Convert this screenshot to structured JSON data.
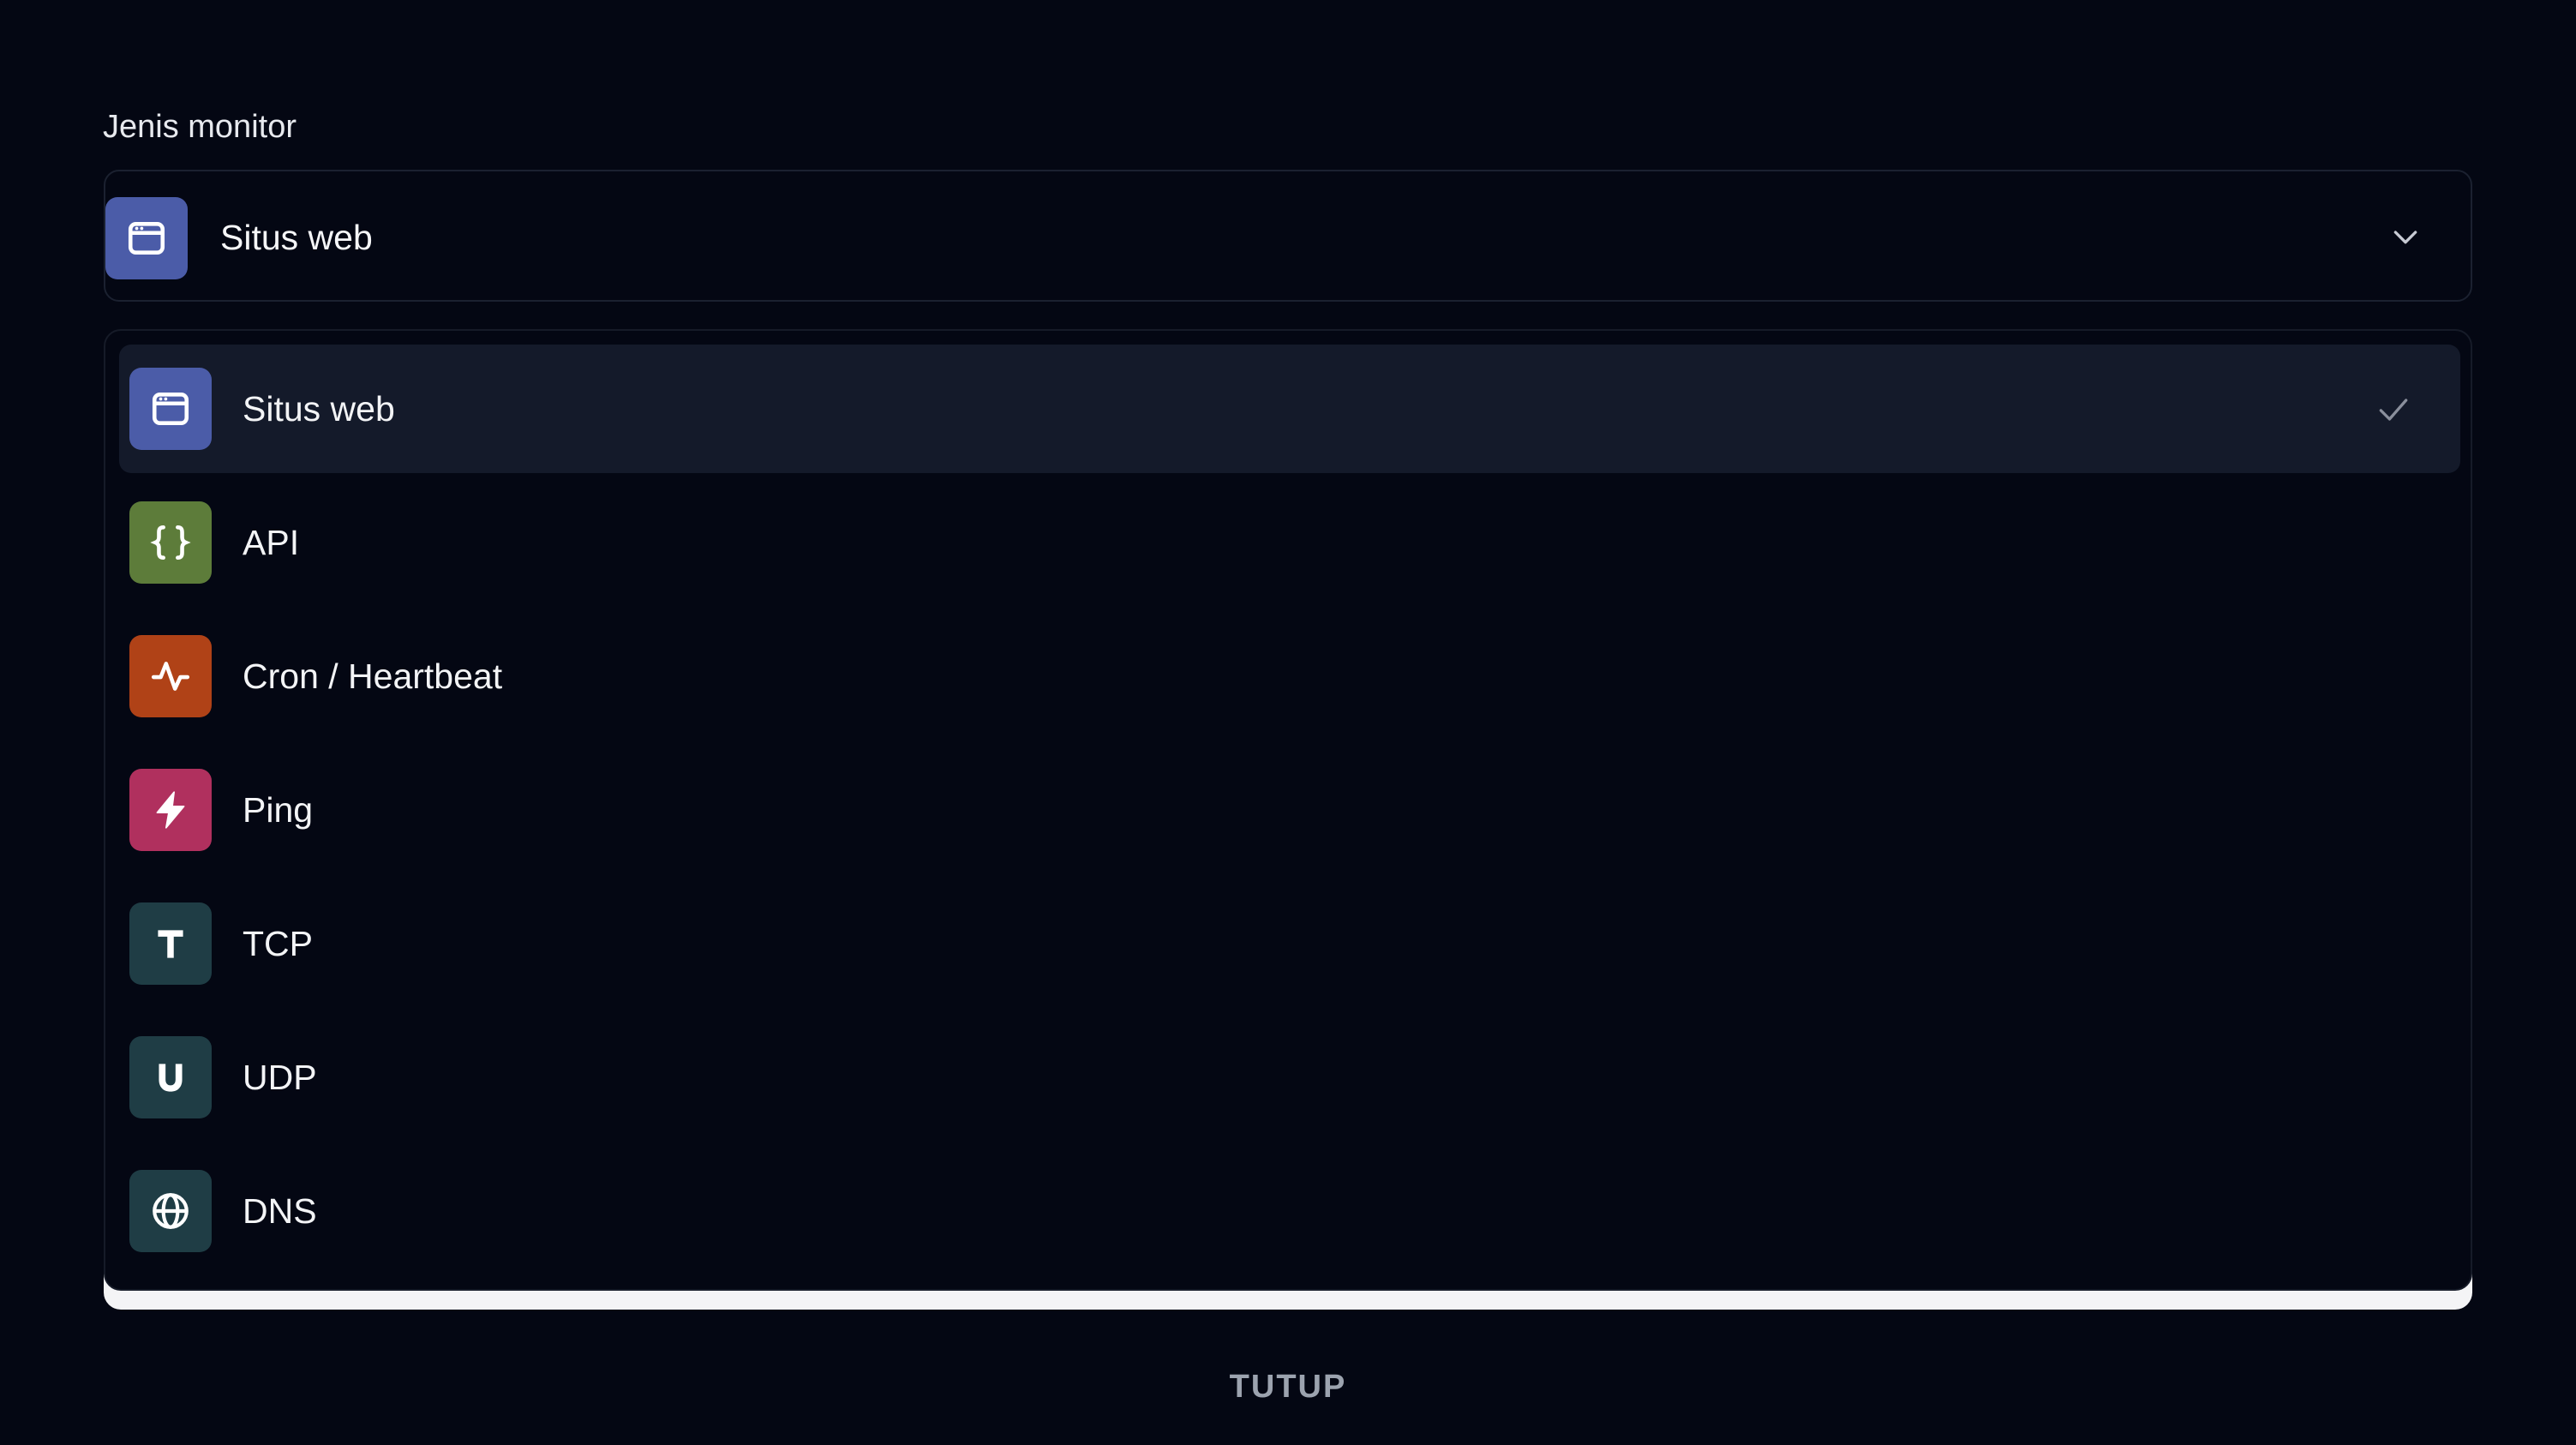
{
  "form": {
    "label": "Jenis monitor",
    "selected": {
      "label": "Situs web",
      "icon": "browser-window-icon",
      "color": "#4b5ca8"
    }
  },
  "options": [
    {
      "label": "Situs web",
      "icon": "browser-window-icon",
      "color": "#4b5ca8",
      "selected": true
    },
    {
      "label": "API",
      "icon": "curly-braces-icon",
      "color": "#5d7c3a",
      "selected": false
    },
    {
      "label": "Cron / Heartbeat",
      "icon": "activity-pulse-icon",
      "color": "#b04217",
      "selected": false
    },
    {
      "label": "Ping",
      "icon": "lightning-bolt-icon",
      "color": "#b0305e",
      "selected": false
    },
    {
      "label": "TCP",
      "icon": "letter-t-icon",
      "color": "#1f3d45",
      "selected": false
    },
    {
      "label": "UDP",
      "icon": "letter-u-icon",
      "color": "#1f3d45",
      "selected": false
    },
    {
      "label": "DNS",
      "icon": "globe-icon",
      "color": "#1f3d45",
      "selected": false
    }
  ],
  "footer": {
    "close_label": "TUTUP"
  }
}
